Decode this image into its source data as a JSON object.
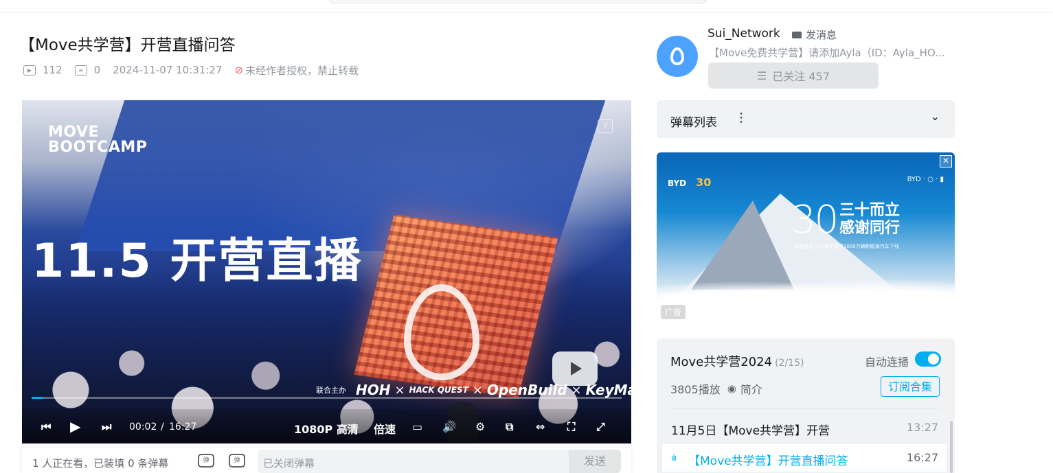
{
  "video": {
    "title": "【Move共学营】开营直播问答",
    "plays": "112",
    "danmaku_count": "0",
    "datetime": "2024-11-07 10:31:27",
    "copyright_notice": "未经作者授权，禁止转载"
  },
  "player": {
    "brand_line1": "MOVE",
    "brand_line2": "BOOTCAMP",
    "headline": "11.5 开营直播",
    "help_glyph": "?",
    "sponsors_label": "联合主办",
    "sponsors": [
      "HOH",
      "×",
      "HACK QUEST",
      "×",
      "OpenBuild",
      "×",
      "KeyMap"
    ],
    "progress_fraction": 0.02,
    "time_current": "00:02",
    "time_separator": "/",
    "time_total": "16:27",
    "quality": "1080P 高清",
    "speed": "倍速"
  },
  "danmaku_bar": {
    "viewers": "1 人正在看，已装填 0 条弹幕",
    "danmaku_toggle_glyph": "弹",
    "danmaku_settings_glyph": "弹",
    "input_placeholder": "已关闭弹幕",
    "send_label": "发送"
  },
  "uploader": {
    "name": "Sui_Network",
    "message_label": "发消息",
    "description": "【Move免费共学营】请添加Ayla（ID：Ayla_HO...",
    "follow_label": "已关注 457"
  },
  "danmaku_list": {
    "label": "弹幕列表"
  },
  "ad": {
    "big_number": "30",
    "tagline_line1": "三十而立",
    "tagline_line2": "感谢同行",
    "sub": "比亚迪成立30周年暨第1000万辆新能源汽车下线",
    "tag": "广告",
    "close_glyph": "✕"
  },
  "collection": {
    "title": "Move共学营2024",
    "position": "(2/15)",
    "autoplay_label": "自动连播",
    "autoplay_on": true,
    "plays": "3805播放",
    "intro_label": "简介",
    "subscribe_label": "订阅合集",
    "episodes": [
      {
        "title": "11月5日【Move共学营】开营",
        "duration": "13:27"
      },
      {
        "title": "【Move共学营】开营直播问答",
        "duration": "16:27"
      }
    ]
  },
  "colors": {
    "accent": "#00aeec",
    "warning": "#f25d59",
    "avatar": "#4da2ff"
  }
}
